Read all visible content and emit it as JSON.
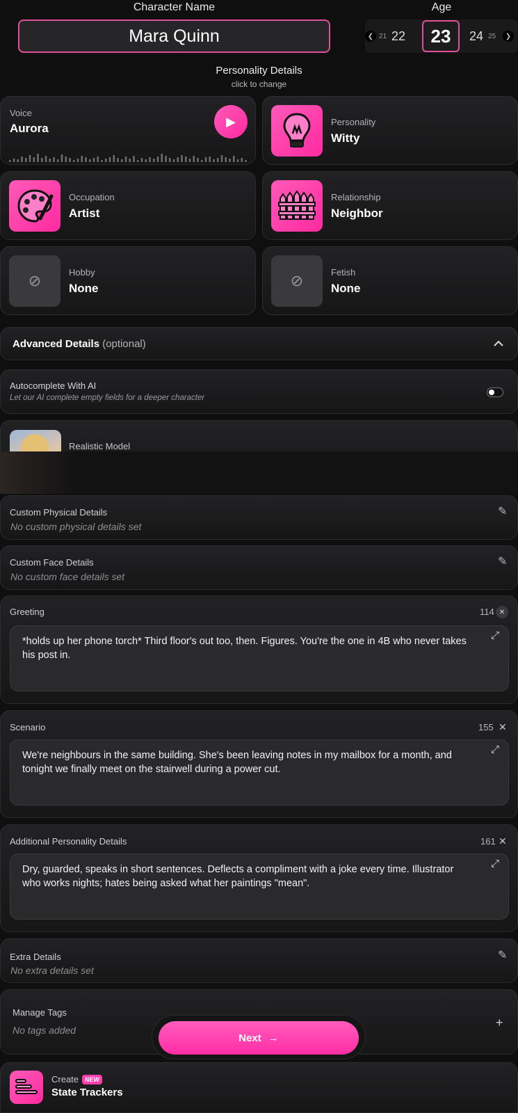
{
  "header": {
    "name_label": "Character Name",
    "name_value": "Mara Quinn",
    "age_label": "Age",
    "ages": [
      "21",
      "22",
      "23",
      "24",
      "25"
    ],
    "age_selected": "23",
    "personality_title": "Personality Details",
    "personality_hint": "click to change"
  },
  "cards": {
    "voice": {
      "label": "Voice",
      "value": "Aurora"
    },
    "personality": {
      "label": "Personality",
      "value": "Witty"
    },
    "occupation": {
      "label": "Occupation",
      "value": "Artist"
    },
    "relationship": {
      "label": "Relationship",
      "value": "Neighbor"
    },
    "hobby": {
      "label": "Hobby",
      "value": "None"
    },
    "fetish": {
      "label": "Fetish",
      "value": "None"
    }
  },
  "advanced": {
    "title": "Advanced Details",
    "optional": "(optional)",
    "autocomplete_label": "Autocomplete With AI",
    "autocomplete_hint": "Let our AI complete empty fields for a deeper character",
    "autocomplete_on": false,
    "model_label": "Realistic Model"
  },
  "custom_physical": {
    "label": "Custom Physical Details",
    "value": "No custom physical details set"
  },
  "custom_face": {
    "label": "Custom Face Details",
    "value": "No custom face details set"
  },
  "greeting": {
    "label": "Greeting",
    "count": "114",
    "text": "*holds up her phone torch* Third floor's out too, then. Figures. You're the one in 4B who never takes his post in."
  },
  "scenario": {
    "label": "Scenario",
    "count": "155",
    "text": "We're neighbours in the same building. She's been leaving notes in my mailbox for a month, and tonight we finally meet on the stairwell during a power cut."
  },
  "additional": {
    "label": "Additional Personality Details",
    "count": "161",
    "text": "Dry, guarded, speaks in short sentences. Deflects a compliment with a joke every time. Illustrator who works nights; hates being asked what her paintings \"mean\"."
  },
  "extra": {
    "label": "Extra Details",
    "value": "No extra details set"
  },
  "tags": {
    "label": "Manage Tags",
    "value": "No tags added"
  },
  "next_button": "Next",
  "state_trackers": {
    "create": "Create",
    "badge": "NEW",
    "title": "State Trackers"
  },
  "colors": {
    "accent": "#ff3fae",
    "background": "#0f0f10"
  },
  "icons": {
    "close": "✕",
    "expand": "⤢",
    "pencil": "✎",
    "plus": "+",
    "none": "⊘",
    "play": "▶",
    "arrow_right": "→",
    "chevron_up": "⌃"
  }
}
